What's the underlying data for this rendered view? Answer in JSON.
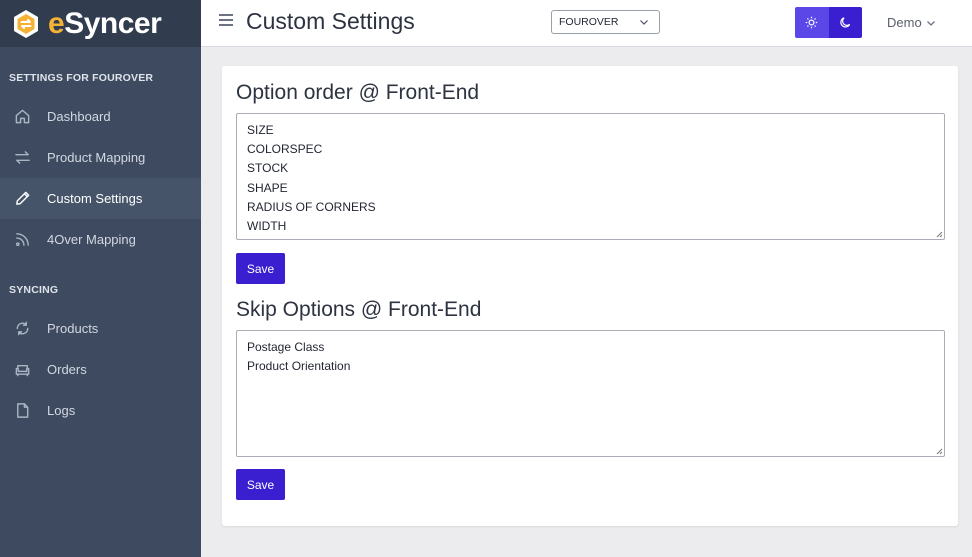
{
  "brand": {
    "name_accent": "e",
    "name_rest": "Syncer"
  },
  "sidebar": {
    "section1_title": "SETTINGS FOR FOUROVER",
    "section1_items": [
      {
        "label": "Dashboard",
        "icon": "home-icon"
      },
      {
        "label": "Product Mapping",
        "icon": "arrows-exchange-icon"
      },
      {
        "label": "Custom Settings",
        "icon": "pencil-icon",
        "active": true
      },
      {
        "label": "4Over Mapping",
        "icon": "rss-icon"
      }
    ],
    "section2_title": "SYNCING",
    "section2_items": [
      {
        "label": "Products",
        "icon": "sync-icon"
      },
      {
        "label": "Orders",
        "icon": "sofa-icon"
      },
      {
        "label": "Logs",
        "icon": "document-icon"
      }
    ]
  },
  "header": {
    "title": "Custom Settings",
    "store_select": "FOUROVER",
    "user": "Demo"
  },
  "option_order": {
    "heading": "Option order @ Front-End",
    "lines": [
      "SIZE",
      "COLORSPEC",
      "STOCK",
      "SHAPE",
      "RADIUS OF CORNERS",
      "WIDTH"
    ],
    "save_label": "Save"
  },
  "skip_options": {
    "heading": "Skip Options @ Front-End",
    "lines": [
      "Postage Class",
      "Product Orientation"
    ],
    "save_label": "Save"
  },
  "colors": {
    "sidebar_bg": "#3d4a5f",
    "brand_bg": "#323c4f",
    "accent": "#3a1fd0",
    "logo_yellow": "#f5b335"
  }
}
